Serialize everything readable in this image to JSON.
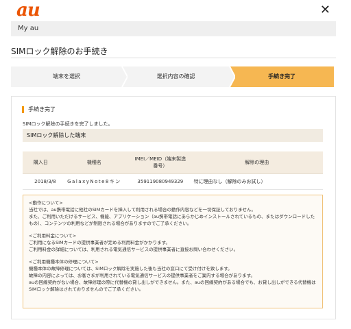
{
  "header": {
    "logo": "au",
    "close": "✕"
  },
  "nav": {
    "myau": "My au"
  },
  "page": {
    "title": "SIMロック解除のお手続き"
  },
  "steps": [
    {
      "label": "端末を選択"
    },
    {
      "label": "選択内容の確認"
    },
    {
      "label": "手続き完了"
    }
  ],
  "complete": {
    "title": "手続き完了",
    "text": "SIMロック解除の手続きを完了しました。"
  },
  "unlocked": {
    "heading": "SIMロック解除した端末",
    "columns": [
      "購入日",
      "機種名",
      "IMEI／MEID（端末製造番号）",
      "解除の理由"
    ],
    "rows": [
      [
        "2018/3/8",
        "GalaxyNote8キン",
        "359119080949329",
        "特に理由なし（解除のみお試し）"
      ]
    ]
  },
  "notes": {
    "op_title": "<動作について>",
    "op_1": "当社では、au携帯電話に他社のSIMカードを挿入して利用される場合の動作内容などを一切保証しておりません。",
    "op_2": "また、ご利用いただけるサービス、機能、アプリケーション（au携帯電話にあらかじめインストールされているもの、またはダウンロードしたもの）、コンテンツの利用などが制限される場合がありますのでご了承ください。",
    "fee_title": "<ご利用料金について>",
    "fee_1": "ご利用になるSIMカードの提供事業者が定める利用料金がかかります。",
    "fee_2": "ご利用料金の詳細については、利用される電気通信サービスの提供事業者に直接お問い合わせください。",
    "repair_title": "<ご利用機種本体の修理について>",
    "repair_1": "機種本体の故障修理については、SIMロック解除を実施した後も当社の窓口にて受け付けを致します。",
    "repair_2": "故障の内容によっては、お客さまが利用されている電気通信サービスの提供事業者をご案内する場合があります。",
    "repair_3": "auの回線契約がない場合、故障修理の際に代替機の貸し出しができません。また、auの回線契約がある場合でも、お貸し出しができる代替機はSIMロック解除はされておりませんのでご了承ください。"
  },
  "colors": {
    "accent": "#f39800",
    "brand": "#eb5505",
    "step_active": "#f6b752"
  }
}
